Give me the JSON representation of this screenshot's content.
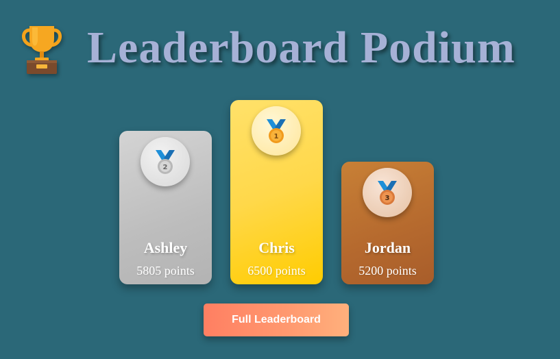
{
  "header": {
    "title": "Leaderboard Podium",
    "icon": "trophy-icon"
  },
  "podium": [
    {
      "rank": 2,
      "medal_label": "2",
      "name": "Ashley",
      "points": "5805 points",
      "color": "#c0c0c0"
    },
    {
      "rank": 1,
      "medal_label": "1",
      "name": "Chris",
      "points": "6500 points",
      "color": "#ffd700"
    },
    {
      "rank": 3,
      "medal_label": "3",
      "name": "Jordan",
      "points": "5200 points",
      "color": "#b8672e"
    }
  ],
  "actions": {
    "full_leaderboard_label": "Full Leaderboard"
  },
  "colors": {
    "background": "#2b6878",
    "title": "#a6b1d6",
    "button": "#ff8c68"
  }
}
